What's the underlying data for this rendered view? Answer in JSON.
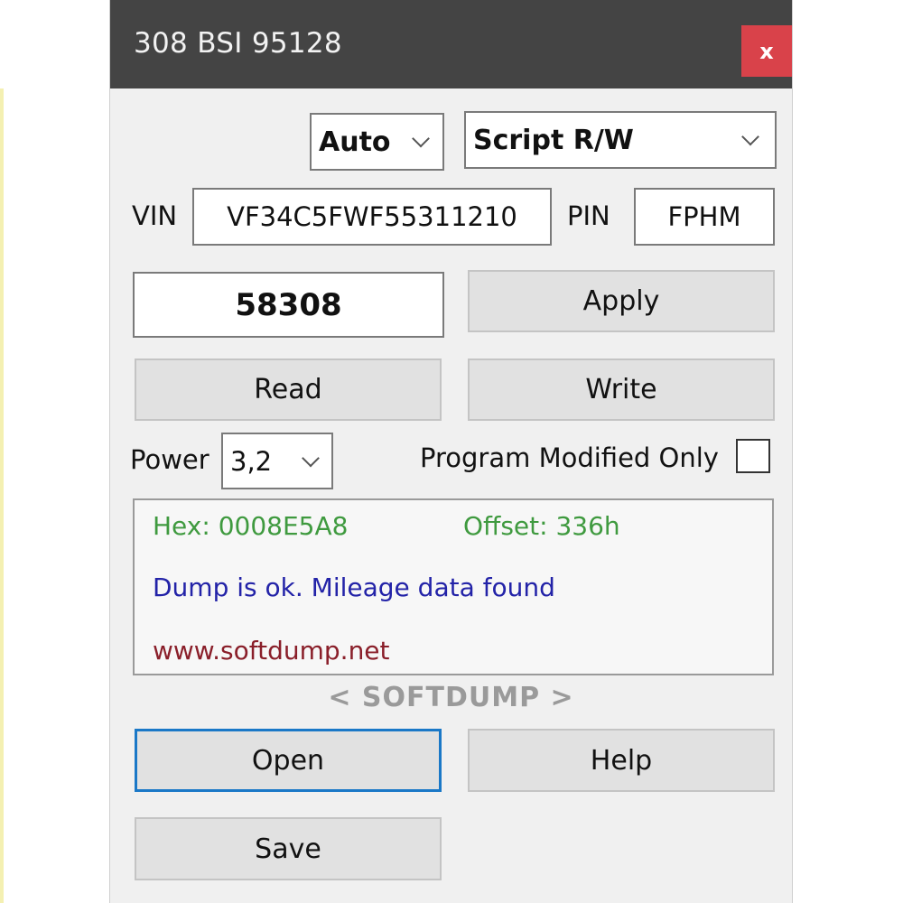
{
  "window": {
    "title": "308 BSI 95128",
    "close_label": "x"
  },
  "mode_select": {
    "value": "Auto"
  },
  "script_select": {
    "value": "Script R/W"
  },
  "vin": {
    "label": "VIN",
    "value": "VF34C5FWF55311210"
  },
  "pin": {
    "label": "PIN",
    "value": "FPHM"
  },
  "mileage": {
    "value": "58308"
  },
  "buttons": {
    "apply": "Apply",
    "read": "Read",
    "write": "Write",
    "open": "Open",
    "help": "Help",
    "save": "Save"
  },
  "power": {
    "label": "Power",
    "value": "3,2"
  },
  "program_modified": {
    "label": "Program Modified Only",
    "checked": false
  },
  "log": {
    "hex": "Hex: 0008E5A8",
    "offset": "Offset: 336h",
    "status": "Dump is ok. Mileage data found",
    "url": "www.softdump.net"
  },
  "brand": "< SOFTDUMP >",
  "colors": {
    "titlebar": "#444444",
    "close": "#d9424a",
    "log_green": "#3f9a3f",
    "log_blue": "#2323a8",
    "log_red": "#8a1f2a",
    "focus": "#1a78c7"
  }
}
